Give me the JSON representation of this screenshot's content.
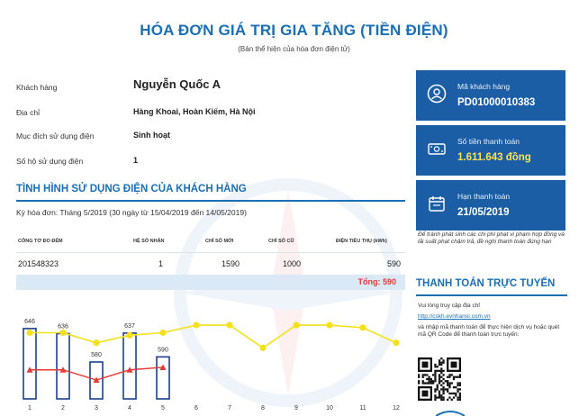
{
  "header": {
    "title": "HÓA ĐƠN GIÁ TRỊ GIA TĂNG (TIỀN ĐIỆN)",
    "subtitle": "(Bản thể hiện của hóa đơn điện tử)"
  },
  "customer": {
    "name_label": "Khách hàng",
    "name": "Nguyễn Quốc A",
    "address_label": "Địa chỉ",
    "address": "Hàng Khoai, Hoàn Kiếm, Hà Nội",
    "purpose_label": "Mục đích sử dụng điện",
    "purpose": "Sinh hoạt",
    "households_label": "Số hộ sử dụng điện",
    "households": "1"
  },
  "usage": {
    "section_title": "TÌNH HÌNH SỬ DỤNG ĐIỆN CỦA KHÁCH HÀNG",
    "period": "Kỳ hóa đơn: Tháng 5/2019 (30 ngày từ 15/04/2019 đến 14/05/2019)",
    "columns": [
      "CÔNG TƠ ĐO ĐẾM",
      "HỆ SỐ NHÂN",
      "CHỈ SỐ MỚI",
      "CHỈ SỐ CŨ",
      "ĐIỆN TIÊU THỤ (kWh)"
    ],
    "row": {
      "meter": "201548323",
      "multiplier": "1",
      "new_index": "1590",
      "old_index": "1000",
      "consumption": "590"
    },
    "total": "Tổng: 590"
  },
  "cards": {
    "customer_code_label": "Mã khách hàng",
    "customer_code": "PD01000010383",
    "amount_label": "Số tiền thanh toán",
    "amount": "1.611.643 đồng",
    "due_label": "Hạn thanh toán",
    "due_date": "21/05/2019"
  },
  "note": "Để tránh phát sinh các chi phí phạt vi phạm hợp đồng và lãi suất phạt chậm trả, đề nghị thanh toán đúng hạn",
  "payment": {
    "title": "THANH TOÁN TRỰC TUYẾN",
    "intro": "Vui lòng truy cập địa chỉ",
    "link": "http://cskh.evnhanoi.com.vn",
    "instructions": "và nhập mã thanh toán để thực hiện dịch vụ hoặc quét mã QR Code để thanh toán trực tuyến:"
  },
  "colors": {
    "primary": "#1a6fb5",
    "card": "#1c5ea5",
    "amount": "#ffe14d",
    "total": "#e53935",
    "line_yellow": "#f4e11b",
    "line_red": "#e53935",
    "bar_border": "#1c3f8f"
  },
  "chart_data": {
    "type": "bar",
    "categories": [
      "1",
      "2",
      "3",
      "4",
      "5",
      "6",
      "7",
      "8",
      "9",
      "10",
      "11",
      "12"
    ],
    "series": [
      {
        "values": [
          646,
          636,
          580,
          637,
          590
        ]
      },
      {
        "values": [
          620,
          620,
          600,
          615,
          620,
          635,
          635,
          590,
          635,
          635,
          630,
          600
        ]
      },
      {
        "values": [
          600,
          600,
          580,
          600,
          605
        ]
      }
    ],
    "data_labels": [
      "646",
      "636",
      "580",
      "637",
      "590"
    ],
    "grid": false
  }
}
